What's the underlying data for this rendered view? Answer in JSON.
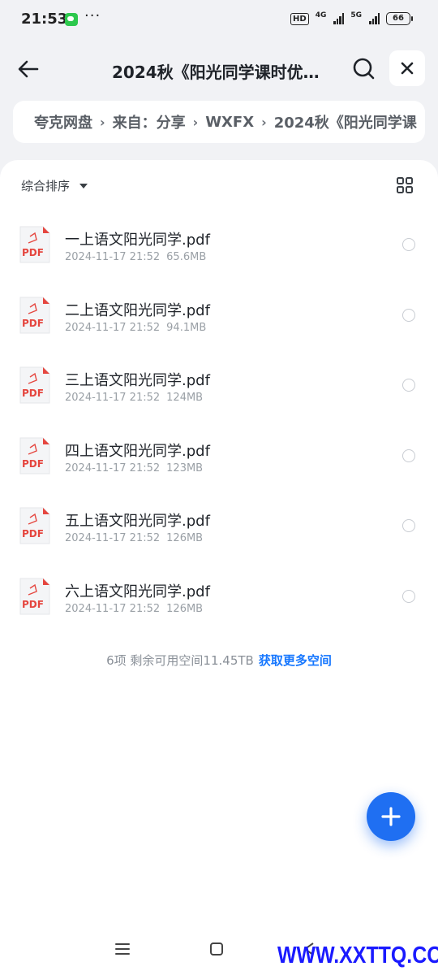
{
  "status_bar": {
    "time": "21:53",
    "hd_label": "HD",
    "net1": "4G",
    "net2": "5G",
    "battery": "66"
  },
  "header": {
    "title": "2024秋《阳光同学课时优…",
    "back_icon": "arrow-left-icon",
    "search_icon": "search-icon",
    "close_icon": "close-icon"
  },
  "breadcrumb": {
    "items": [
      "夸克网盘",
      "来自：分享",
      "WXFX",
      "2024秋《阳光同学课"
    ]
  },
  "toolbar": {
    "sort_label": "综合排序",
    "view_icon": "grid-view-icon"
  },
  "files": [
    {
      "name": "一上语文阳光同学.pdf",
      "date": "2024-11-17 21:52",
      "size": "65.6MB"
    },
    {
      "name": "二上语文阳光同学.pdf",
      "date": "2024-11-17 21:52",
      "size": "94.1MB"
    },
    {
      "name": "三上语文阳光同学.pdf",
      "date": "2024-11-17 21:52",
      "size": "124MB"
    },
    {
      "name": "四上语文阳光同学.pdf",
      "date": "2024-11-17 21:52",
      "size": "123MB"
    },
    {
      "name": "五上语文阳光同学.pdf",
      "date": "2024-11-17 21:52",
      "size": "126MB"
    },
    {
      "name": "六上语文阳光同学.pdf",
      "date": "2024-11-17 21:52",
      "size": "126MB"
    }
  ],
  "pdf_badge": "PDF",
  "footer": {
    "summary": "6项  剩余可用空间11.45TB",
    "link": "获取更多空间"
  },
  "fab_icon": "plus-icon",
  "watermark": "WWW.XXTTQ.COM",
  "colors": {
    "accent": "#1f6ff2",
    "link": "#1677ff",
    "pdf_red": "#e5463f",
    "watermark": "#1a1aff"
  }
}
